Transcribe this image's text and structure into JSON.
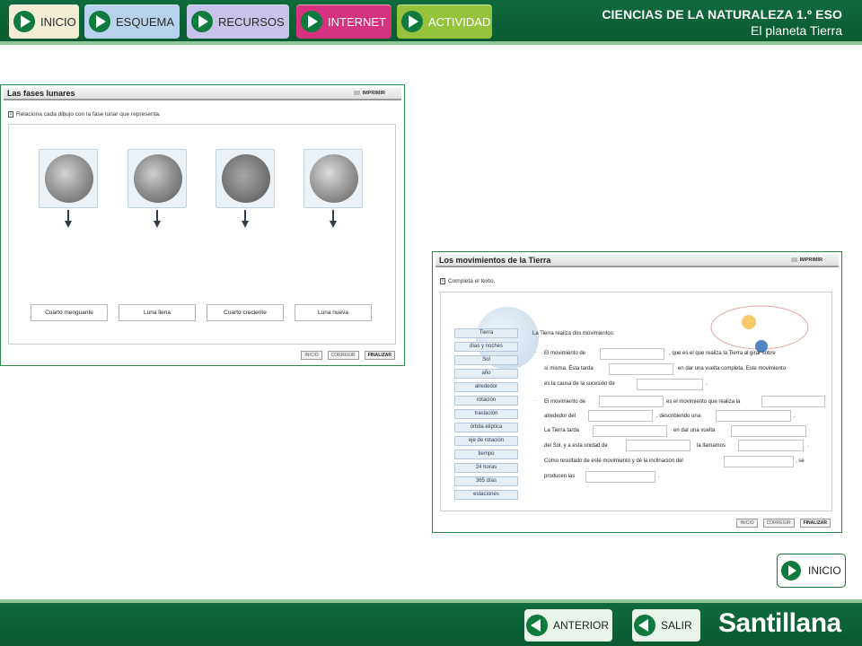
{
  "header": {
    "nav": [
      "INICIO",
      "ESQUEMA",
      "RECURSOS",
      "INTERNET",
      "ACTIVIDAD"
    ],
    "title": "CIENCIAS DE LA NATURALEZA 1.º ESO",
    "subtitle": "El planeta Tierra"
  },
  "footer": {
    "anterior": "ANTERIOR",
    "salir": "SALIR",
    "brand": "Santillana",
    "inicio": "INICIO"
  },
  "panel1": {
    "title": "Las fases lunares",
    "print": "IMPRIMIR",
    "instruction": "Relaciona cada dibujo con la fase lunar que representa.",
    "phases": [
      "Cuarto menguante",
      "Luna llena",
      "Cuarto creciente",
      "Luna nueva"
    ],
    "buttons": [
      "INICIO",
      "CORREGIR",
      "FINALIZAR"
    ]
  },
  "panel2": {
    "title": "Los movimientos de la Tierra",
    "print": "IMPRIMIR",
    "instruction": "Completa el texto.",
    "words": [
      "Tierra",
      "días y noches",
      "Sol",
      "año",
      "alrededor",
      "rotación",
      "traslación",
      "órbita elíptica",
      "eje de rotación",
      "tiempo",
      "24 horas",
      "365 días",
      "estaciones"
    ],
    "intro": "La Tierra realiza dos movimientos:",
    "text": {
      "l1a": "El movimiento de",
      "l1b": ", que es el que realiza la Tierra al girar sobre",
      "l2a": "sí misma. Ésta tarda",
      "l2b": "en dar una vuelta completa. Este movimiento",
      "l3a": "es la causa de la sucesión de",
      "l3b": ".",
      "l4a": "El movimiento de",
      "l4b": "es el movimiento que realiza la",
      "l5a": "alrededor del",
      "l5b": ", describiendo una",
      "l5c": ".",
      "l6a": "La Tierra tarda",
      "l6b": "en dar una vuelta",
      "l7a": "del Sol, y a esta unidad de",
      "l7b": "la llamamos",
      "l7c": ".",
      "l8a": "Como resultado de este movimiento y de la inclinación del",
      "l8b": ", se",
      "l9a": "producen las",
      "l9b": "."
    },
    "buttons": [
      "INICIO",
      "CORREGIR",
      "FINALIZAR"
    ]
  }
}
